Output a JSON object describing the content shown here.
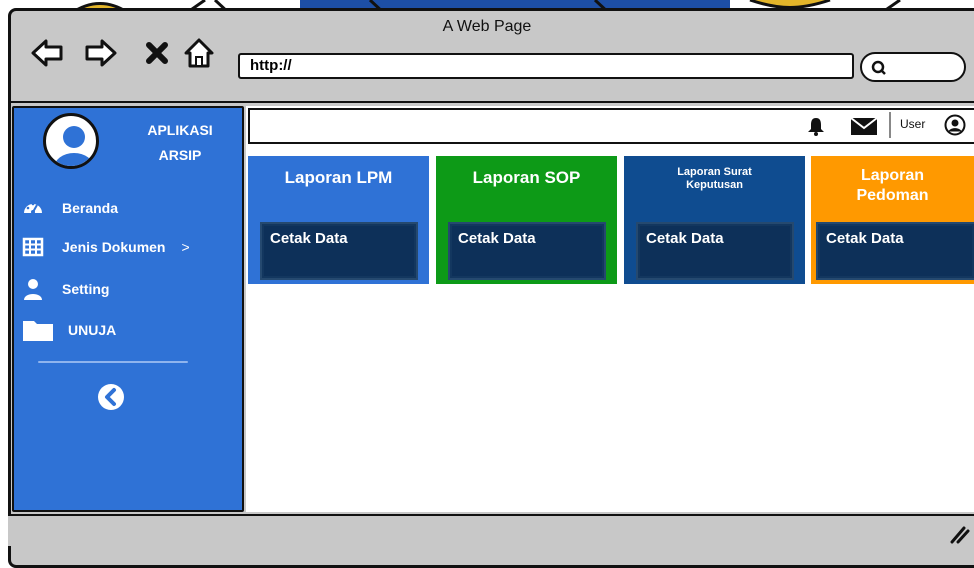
{
  "window": {
    "title": "A Web Page"
  },
  "browser": {
    "url": "http://"
  },
  "sidebar": {
    "app_name_line1": "APLIKASI",
    "app_name_line2": "ARSIP",
    "items": [
      {
        "label": "Beranda",
        "icon": "dashboard-icon"
      },
      {
        "label": "Jenis Dokumen",
        "icon": "table-icon",
        "suffix": ">"
      },
      {
        "label": "Setting",
        "icon": "user-icon"
      },
      {
        "label": "UNUJA",
        "icon": "folder-icon"
      }
    ]
  },
  "header": {
    "user_label": "User"
  },
  "cards": [
    {
      "title": "Laporan LPM",
      "button": "Cetak Data",
      "color": "#2f72d6"
    },
    {
      "title": "Laporan SOP",
      "button": "Cetak Data",
      "color": "#0d9a17"
    },
    {
      "title": "Laporan Surat Keputusan",
      "button": "Cetak Data",
      "color": "#0f4c90"
    },
    {
      "title": "Laporan Pedoman",
      "button": "Cetak Data",
      "color": "#ff9900"
    }
  ]
}
